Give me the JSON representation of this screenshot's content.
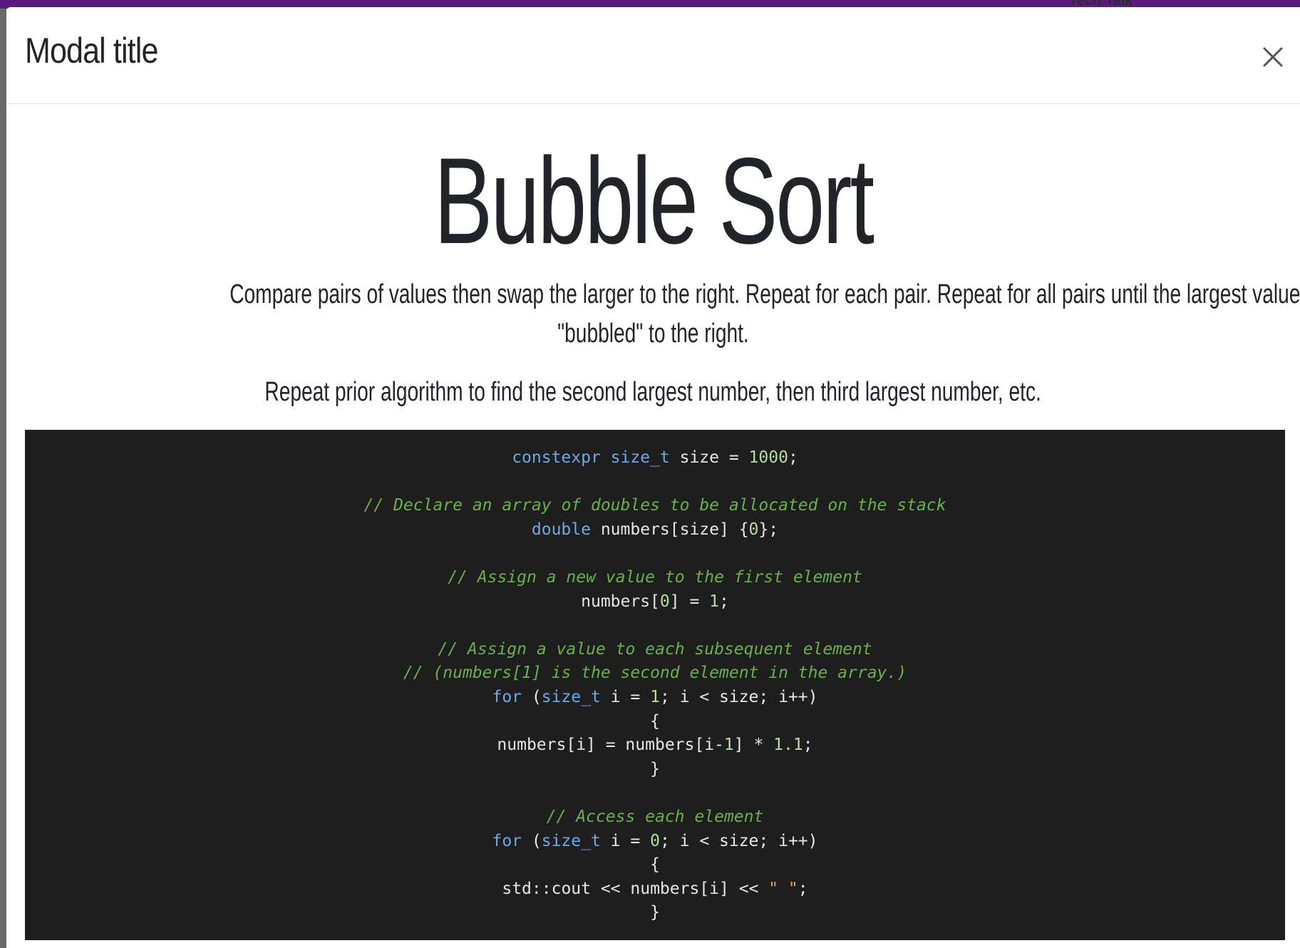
{
  "background": {
    "nav_fragment": "Tech Talk"
  },
  "modal": {
    "title": "Modal title",
    "close_label": "×"
  },
  "content": {
    "heading": "Bubble Sort",
    "description_line_1": "Compare pairs of values then swap the larger to the right. Repeat for each pair. Repeat for all pairs until the largest value has",
    "description_line_2": "\"bubbled\" to the right.",
    "description_2": "Repeat prior algorithm to find the second largest number, then third largest number, etc."
  },
  "code": {
    "language": "cpp",
    "colors": {
      "background": "#1e1e1e",
      "keyword": "#6fa8e6",
      "number": "#b8dca0",
      "comment": "#6ab04c",
      "string": "#d8a468",
      "text": "#e6e6e6"
    },
    "lines": [
      [
        [
          "kw",
          "constexpr"
        ],
        [
          "t",
          " "
        ],
        [
          "kw",
          "size_t"
        ],
        [
          "t",
          " size = "
        ],
        [
          "num",
          "1000"
        ],
        [
          "t",
          ";"
        ]
      ],
      [],
      [
        [
          "cm",
          "// Declare an array of doubles to be allocated on the stack"
        ]
      ],
      [
        [
          "kw",
          "double"
        ],
        [
          "t",
          " numbers[size] {"
        ],
        [
          "num",
          "0"
        ],
        [
          "t",
          "};"
        ]
      ],
      [],
      [
        [
          "cm",
          "// Assign a new value to the first element"
        ]
      ],
      [
        [
          "t",
          "numbers["
        ],
        [
          "num",
          "0"
        ],
        [
          "t",
          "] = "
        ],
        [
          "num",
          "1"
        ],
        [
          "t",
          ";"
        ]
      ],
      [],
      [
        [
          "cm",
          "// Assign a value to each subsequent element"
        ]
      ],
      [
        [
          "cm",
          "// (numbers[1] is the second element in the array.)"
        ]
      ],
      [
        [
          "kw",
          "for"
        ],
        [
          "t",
          " ("
        ],
        [
          "kw",
          "size_t"
        ],
        [
          "t",
          " i = "
        ],
        [
          "num",
          "1"
        ],
        [
          "t",
          "; i < size; i++)"
        ]
      ],
      [
        [
          "t",
          "{"
        ]
      ],
      [
        [
          "t",
          "numbers[i] = numbers[i-"
        ],
        [
          "num",
          "1"
        ],
        [
          "t",
          "] * "
        ],
        [
          "num",
          "1.1"
        ],
        [
          "t",
          ";"
        ]
      ],
      [
        [
          "t",
          "}"
        ]
      ],
      [],
      [
        [
          "cm",
          "// Access each element"
        ]
      ],
      [
        [
          "kw",
          "for"
        ],
        [
          "t",
          " ("
        ],
        [
          "kw",
          "size_t"
        ],
        [
          "t",
          " i = "
        ],
        [
          "num",
          "0"
        ],
        [
          "t",
          "; i < size; i++)"
        ]
      ],
      [
        [
          "t",
          "{"
        ]
      ],
      [
        [
          "t",
          "std::cout << numbers[i] << "
        ],
        [
          "str",
          "\" \""
        ],
        [
          "t",
          ";"
        ]
      ],
      [
        [
          "t",
          "}"
        ]
      ]
    ]
  }
}
